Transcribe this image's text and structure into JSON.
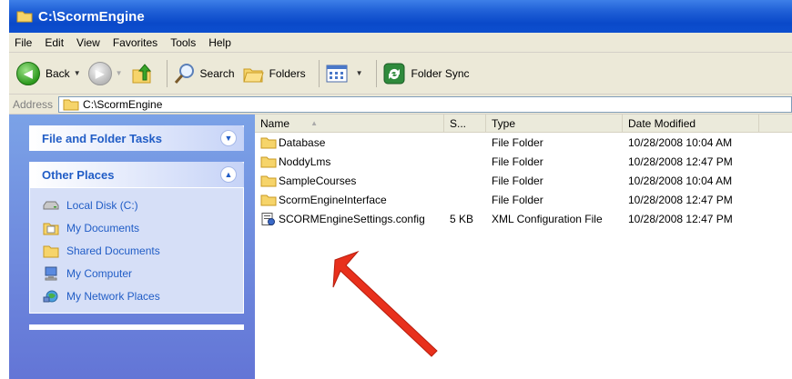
{
  "window": {
    "title": "C:\\ScormEngine"
  },
  "menu": [
    "File",
    "Edit",
    "View",
    "Favorites",
    "Tools",
    "Help"
  ],
  "toolbar": {
    "back_label": "Back",
    "search_label": "Search",
    "folders_label": "Folders",
    "folder_sync_label": "Folder Sync"
  },
  "address": {
    "label": "Address",
    "value": "C:\\ScormEngine"
  },
  "tasks_panel": {
    "title": "File and Folder Tasks"
  },
  "other_places": {
    "title": "Other Places",
    "items": [
      {
        "label": "Local Disk (C:)",
        "icon": "drive-icon"
      },
      {
        "label": "My Documents",
        "icon": "documents-icon"
      },
      {
        "label": "Shared Documents",
        "icon": "folder-icon"
      },
      {
        "label": "My Computer",
        "icon": "computer-icon"
      },
      {
        "label": "My Network Places",
        "icon": "network-icon"
      }
    ]
  },
  "columns": {
    "name": "Name",
    "size": "S...",
    "type": "Type",
    "date": "Date Modified"
  },
  "files": [
    {
      "name": "Database",
      "size": "",
      "type": "File Folder",
      "date": "10/28/2008 10:04 AM",
      "icon": "folder-icon"
    },
    {
      "name": "NoddyLms",
      "size": "",
      "type": "File Folder",
      "date": "10/28/2008 12:47 PM",
      "icon": "folder-icon"
    },
    {
      "name": "SampleCourses",
      "size": "",
      "type": "File Folder",
      "date": "10/28/2008 10:04 AM",
      "icon": "folder-icon"
    },
    {
      "name": "ScormEngineInterface",
      "size": "",
      "type": "File Folder",
      "date": "10/28/2008 12:47 PM",
      "icon": "folder-icon"
    },
    {
      "name": "SCORMEngineSettings.config",
      "size": "5 KB",
      "type": "XML Configuration File",
      "date": "10/28/2008 12:47 PM",
      "icon": "config-file-icon"
    }
  ],
  "colors": {
    "title_bar": "#0a49c9",
    "task_pane": "#6375d6",
    "link_blue": "#215dc6",
    "annotation_arrow": "#e8301c"
  }
}
